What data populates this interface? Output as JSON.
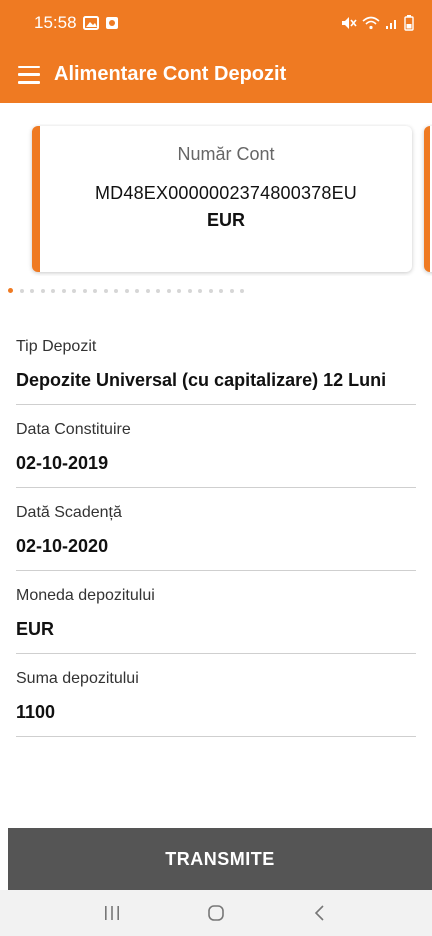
{
  "status_bar": {
    "time": "15:58"
  },
  "app_bar": {
    "title": "Alimentare Cont Depozit"
  },
  "account_card": {
    "label": "Număr Cont",
    "iban": "MD48EX0000002374800378EU",
    "currency": "EUR"
  },
  "carousel": {
    "page_count": 23,
    "active_index": 0
  },
  "fields": [
    {
      "label": "Tip Depozit",
      "value": "Depozite Universal (cu capitalizare) 12 Luni"
    },
    {
      "label": "Data Constituire",
      "value": "02-10-2019"
    },
    {
      "label": "Dată Scadență",
      "value": "02-10-2020"
    },
    {
      "label": "Moneda depozitului",
      "value": "EUR"
    },
    {
      "label": "Suma depozitului",
      "value": "1100"
    }
  ],
  "submit_label": "TRANSMITE",
  "colors": {
    "accent": "#ef7a22",
    "button": "#555555"
  }
}
